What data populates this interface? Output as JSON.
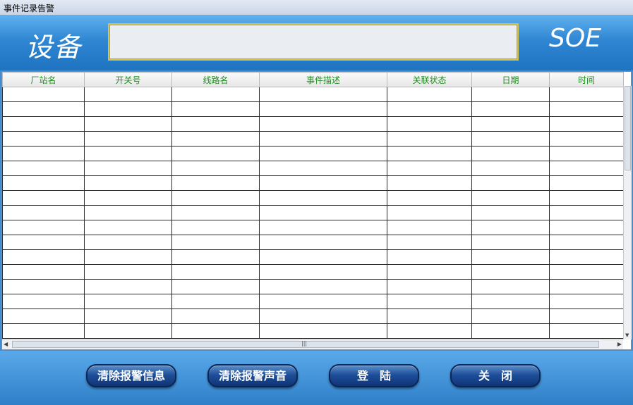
{
  "window": {
    "title": "事件记录告警"
  },
  "header": {
    "left_label": "设备",
    "right_label": "SOE"
  },
  "table": {
    "columns": [
      "厂站名",
      "开关号",
      "线路名",
      "事件描述",
      "关联状态",
      "日期",
      "时间"
    ],
    "row_count": 17
  },
  "buttons": {
    "clear_alarm_info": "清除报警信息",
    "clear_alarm_sound": "清除报警声音",
    "login": "登　陆",
    "close": "关　闭"
  },
  "colors": {
    "header_bg": "#2f86d2",
    "column_header_text": "#1f8f1f",
    "button_bg": "#1e4f9a"
  }
}
